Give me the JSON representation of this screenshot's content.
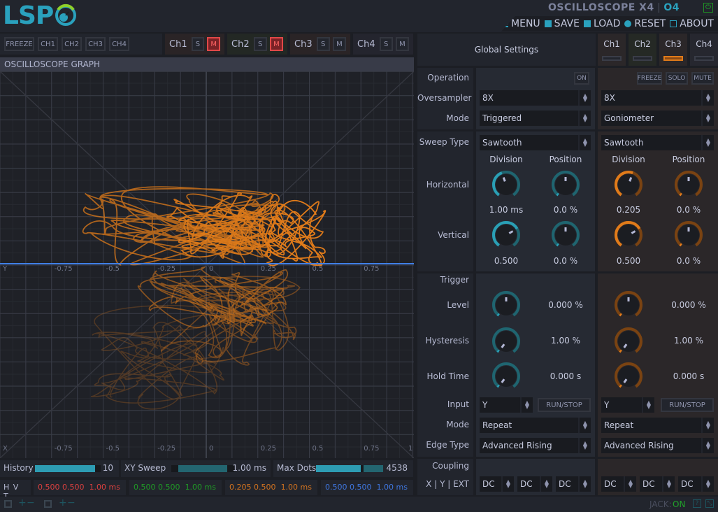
{
  "app": {
    "title": "OSCILLOSCOPE X4",
    "version": "O4",
    "logo": "LSP",
    "power_icon": "power-icon"
  },
  "menu": [
    {
      "label": "MENU",
      "icon": "menu-icon"
    },
    {
      "label": "SAVE",
      "icon": "save-icon"
    },
    {
      "label": "LOAD",
      "icon": "load-icon"
    },
    {
      "label": "RESET",
      "icon": "reset-icon"
    },
    {
      "label": "ABOUT",
      "icon": "about-icon"
    }
  ],
  "toolbar": {
    "freeze": "FREEZE",
    "channels": [
      "CH1",
      "CH2",
      "CH3",
      "CH4"
    ],
    "ch_groups": [
      {
        "label": "Ch1",
        "solo": "S",
        "mute": "M",
        "mute_on": true
      },
      {
        "label": "Ch2",
        "solo": "S",
        "mute": "M",
        "mute_on": true
      },
      {
        "label": "Ch3",
        "solo": "S",
        "mute": "M",
        "mute_on": false
      },
      {
        "label": "Ch4",
        "solo": "S",
        "mute": "M",
        "mute_on": false
      }
    ]
  },
  "graph": {
    "title": "OSCILLOSCOPE GRAPH",
    "y_axis_label": "Y",
    "x_axis_label": "X",
    "ticks": [
      "-0.75",
      "-0.5",
      "-0.25",
      "0",
      "0.25",
      "0.5",
      "0.75"
    ],
    "x_end_tick": "1",
    "trace_color": "#e07b1a",
    "hline_color": "#3f7fe6"
  },
  "global": {
    "title": "Global Settings",
    "tabs": [
      {
        "label": "Ch1",
        "selected": false
      },
      {
        "label": "Ch2",
        "selected": false
      },
      {
        "label": "Ch3",
        "selected": true
      },
      {
        "label": "Ch4",
        "selected": false
      }
    ]
  },
  "labels": {
    "operation": "Operation",
    "oversampler": "Oversampler",
    "mode": "Mode",
    "sweep_type": "Sweep Type",
    "horizontal": "Horizontal",
    "vertical": "Vertical",
    "division": "Division",
    "position": "Position",
    "trigger": "Trigger",
    "level": "Level",
    "hysteresis": "Hysteresis",
    "hold_time": "Hold Time",
    "input": "Input",
    "trig_mode": "Mode",
    "edge_type": "Edge Type",
    "coupling": "Coupling",
    "xyext": "X | Y | EXT"
  },
  "left": {
    "on": "ON",
    "oversampler": "8X",
    "mode": "Triggered",
    "sweep_type": "Sawtooth",
    "h_division": "1.00 ms",
    "h_position": "0.0 %",
    "v_division": "0.500",
    "v_position": "0.0 %",
    "level": "0.000 %",
    "hysteresis": "1.00 %",
    "hold_time": "0.000 s",
    "input": "Y",
    "runstop": "RUN/STOP",
    "trig_mode": "Repeat",
    "edge_type": "Advanced Rising",
    "coupling": [
      "DC",
      "DC",
      "DC"
    ],
    "accent": "#2a9fb5"
  },
  "right": {
    "freeze": "FREEZE",
    "solo": "SOLO",
    "mute": "MUTE",
    "oversampler": "8X",
    "mode": "Goniometer",
    "sweep_type": "Sawtooth",
    "h_division": "0.205",
    "h_position": "0.0 %",
    "v_division": "0.500",
    "v_position": "0.0 %",
    "level": "0.000 %",
    "hysteresis": "1.00 %",
    "hold_time": "0.000 s",
    "input": "Y",
    "runstop": "RUN/STOP",
    "trig_mode": "Repeat",
    "edge_type": "Advanced Rising",
    "coupling": [
      "DC",
      "DC",
      "DC"
    ],
    "accent": "#e07b1a"
  },
  "bottom": {
    "history_label": "History",
    "history_value": "10",
    "history_fill": 0.92,
    "xy_label": "XY Sweep",
    "xy_value": "1.00 ms",
    "xy_fill": 0.88,
    "maxdots_label": "Max Dots",
    "maxdots_value": "4538",
    "maxdots_fill": 0.55,
    "hvt": "H  V  T",
    "channels": [
      {
        "h": "0.500",
        "v": "0.500",
        "t": "1.00 ms",
        "color": "#d9403f"
      },
      {
        "h": "0.500",
        "v": "0.500",
        "t": "1.00 ms",
        "color": "#1f9a26"
      },
      {
        "h": "0.205",
        "v": "0.500",
        "t": "1.00 ms",
        "color": "#d27320"
      },
      {
        "h": "0.500",
        "v": "0.500",
        "t": "1.00 ms",
        "color": "#3f76de"
      }
    ]
  },
  "status": {
    "jack_label": "JACK:",
    "jack_value": "ON"
  }
}
